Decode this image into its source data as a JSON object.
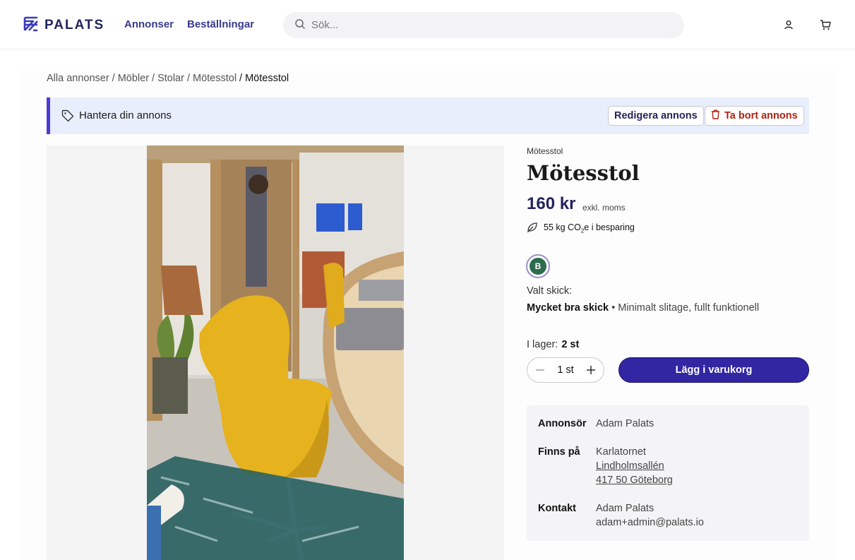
{
  "header": {
    "logo_text": "PALATS",
    "nav": [
      {
        "label": "Annonser"
      },
      {
        "label": "Beställningar"
      }
    ],
    "search": {
      "placeholder": "Sök...",
      "value": ""
    },
    "icons": [
      "search-icon",
      "user-icon",
      "cart-icon"
    ]
  },
  "breadcrumb": {
    "items": [
      "Alla annonser",
      "Möbler",
      "Stolar",
      "Mötesstol"
    ],
    "current": "Mötesstol",
    "separator": "/"
  },
  "manage_bar": {
    "text": "Hantera din annons",
    "edit_label": "Redigera annons",
    "delete_label": "Ta bort annons"
  },
  "product": {
    "category": "Mötesstol",
    "title": "Mötesstol",
    "price": "160 kr",
    "vat_note": "exkl. moms",
    "co2_prefix": "55 kg CO",
    "co2_sub": "2",
    "co2_suffix": "e i besparing",
    "grade": "B",
    "condition_label": "Valt skick:",
    "condition_name": "Mycket bra skick",
    "condition_separator": "•",
    "condition_desc": "Minimalt slitage, fullt funktionell",
    "stock_label": "I lager:",
    "stock_value": "2 st",
    "quantity": "1 st",
    "add_to_cart_label": "Lägg i varukorg"
  },
  "seller": {
    "advertiser_label": "Annonsör",
    "advertiser_value": "Adam Palats",
    "location_label": "Finns på",
    "location_name": "Karlatornet",
    "location_street": "Lindholmsallén",
    "location_city": "417 50 Göteborg",
    "contact_label": "Kontakt",
    "contact_name": "Adam Palats",
    "contact_email": "adam+admin@palats.io"
  },
  "colors": {
    "brand_navy": "#23235c",
    "accent": "#3326a3",
    "grade_green": "#2d6b4e",
    "delete_red": "#b2200f",
    "manage_bg": "#e9eefc"
  }
}
